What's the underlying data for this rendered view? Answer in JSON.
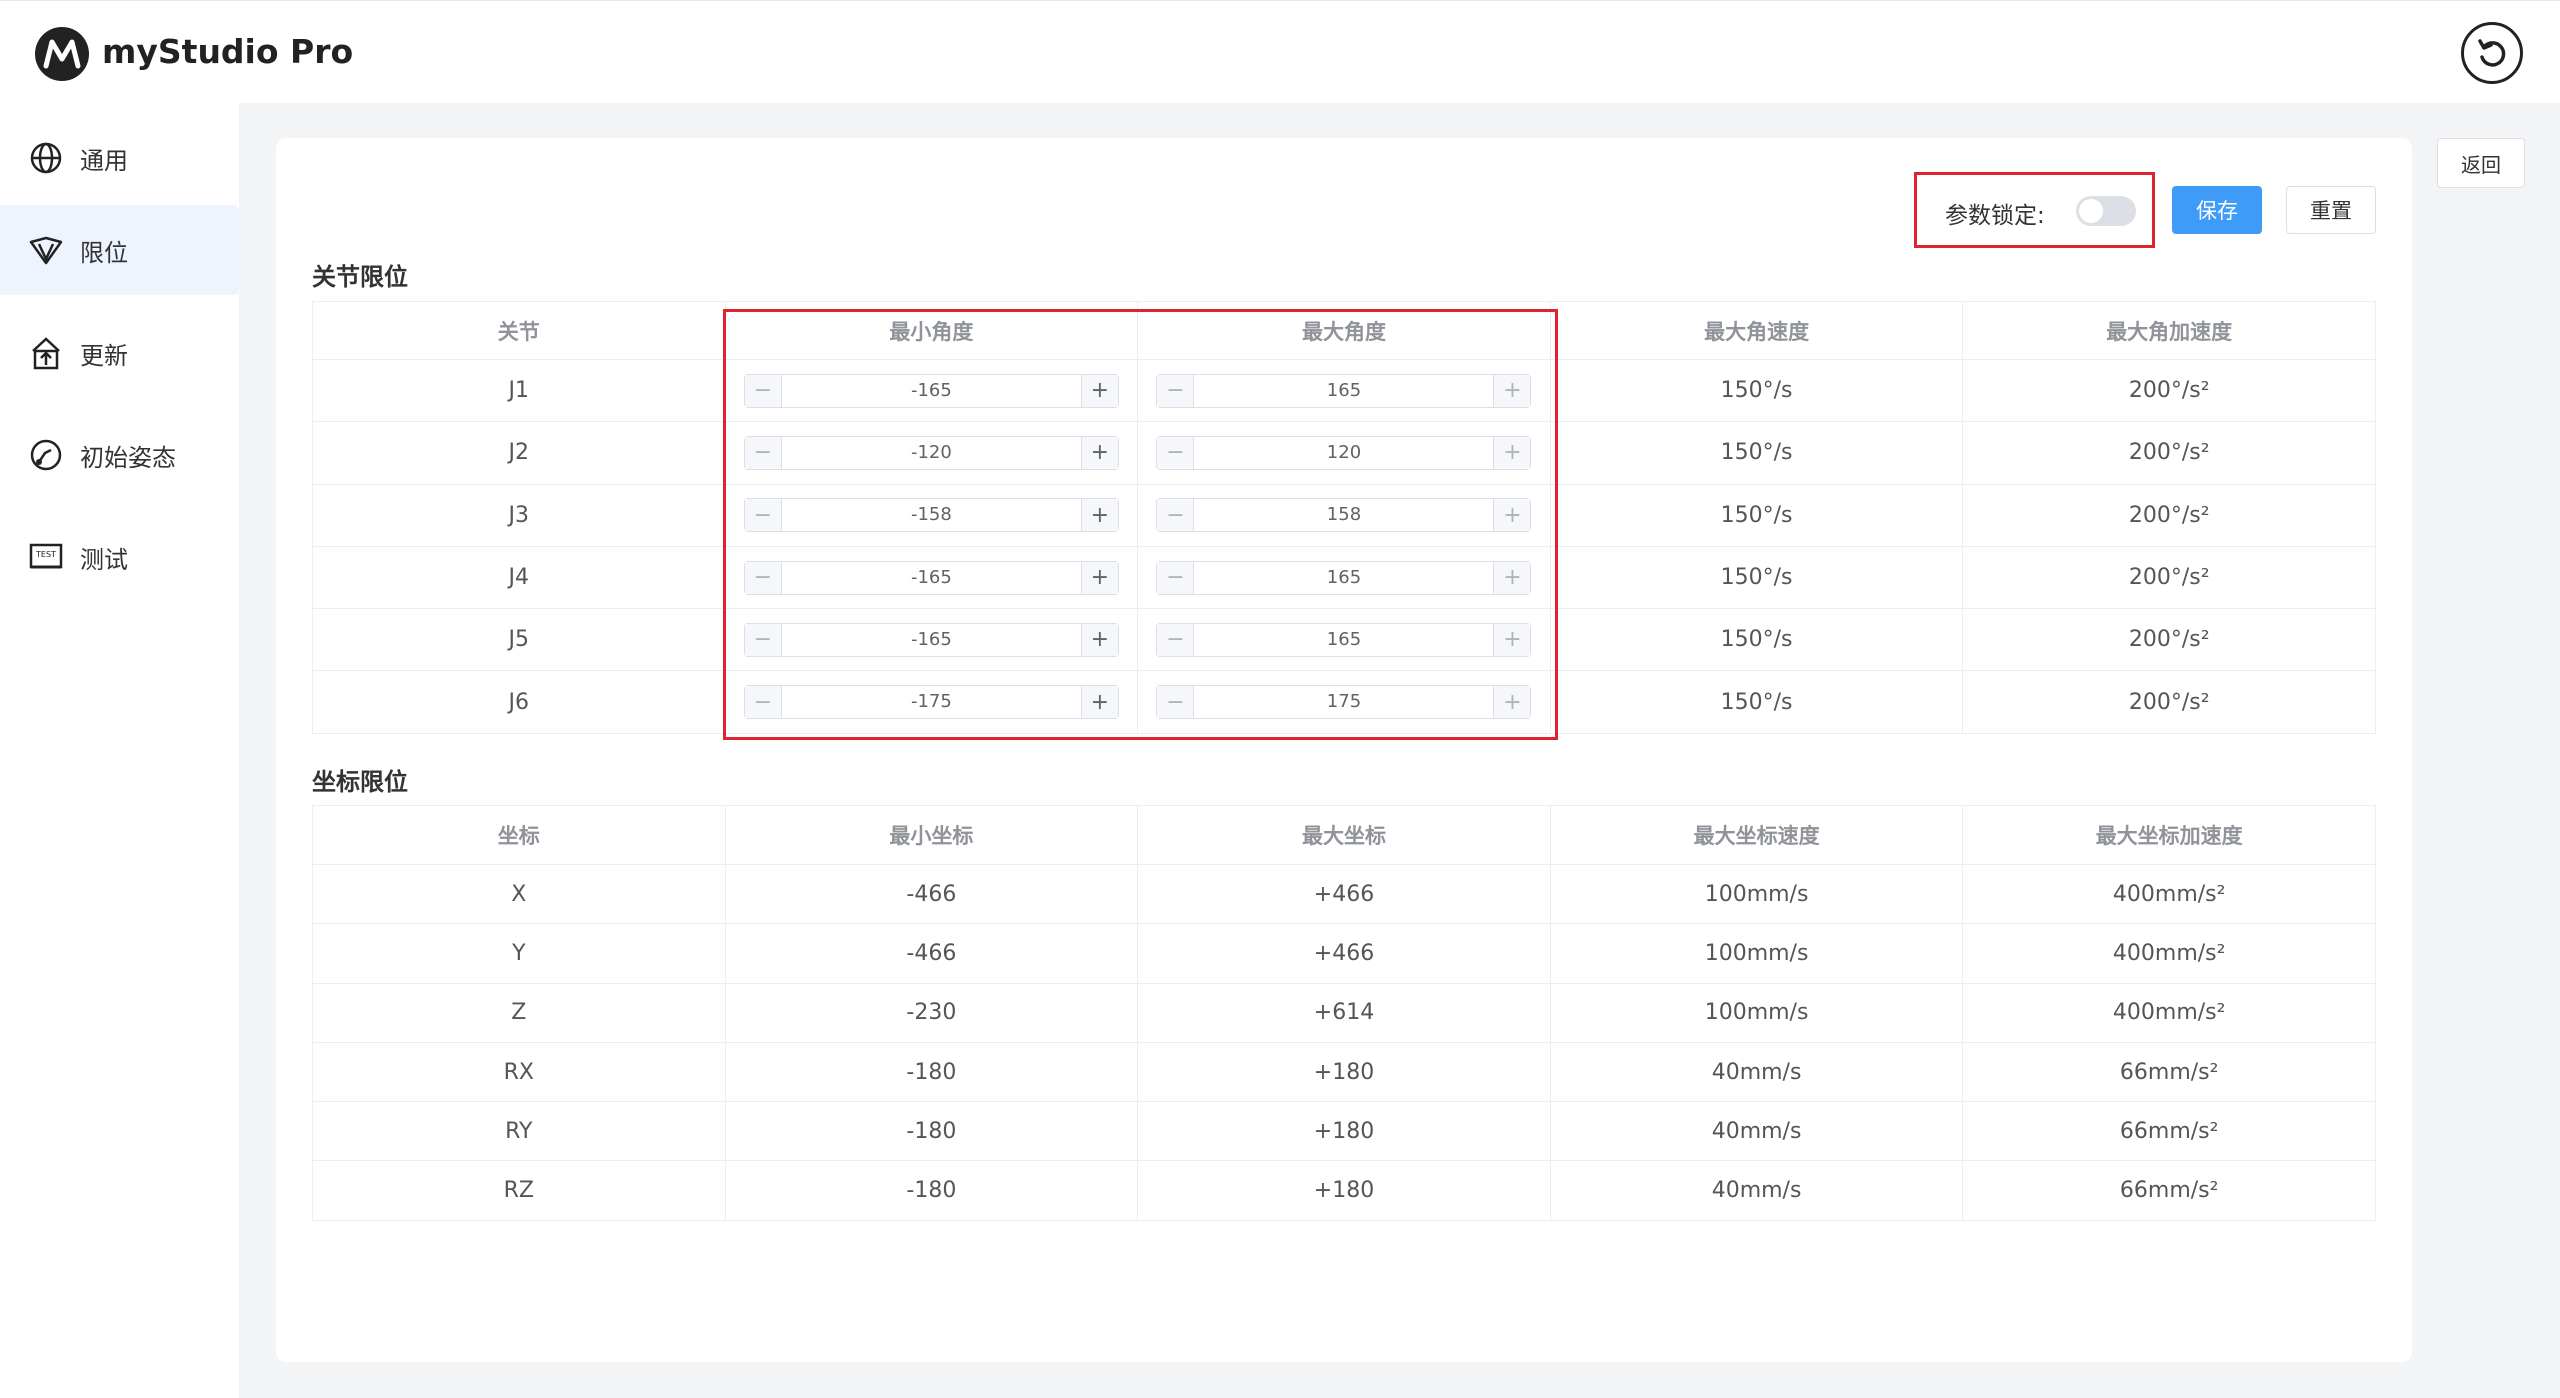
{
  "app": {
    "title": "myStudio Pro"
  },
  "sidebar": {
    "items": [
      {
        "label": "通用",
        "icon": "globe-icon",
        "active": false
      },
      {
        "label": "限位",
        "icon": "limit-icon",
        "active": true
      },
      {
        "label": "更新",
        "icon": "update-icon",
        "active": false
      },
      {
        "label": "初始姿态",
        "icon": "pose-icon",
        "active": false
      },
      {
        "label": "测试",
        "icon": "test-icon",
        "active": false
      }
    ]
  },
  "toolbar": {
    "back_label": "返回",
    "lock_label": "参数锁定:",
    "lock_on": false,
    "save_label": "保存",
    "reset_label": "重置"
  },
  "joint_section": {
    "title": "关节限位",
    "headers": [
      "关节",
      "最小角度",
      "最大角度",
      "最大角速度",
      "最大角加速度"
    ],
    "rows": [
      {
        "joint": "J1",
        "min": "-165",
        "max": "165",
        "vel": "150°/s",
        "acc": "200°/s²"
      },
      {
        "joint": "J2",
        "min": "-120",
        "max": "120",
        "vel": "150°/s",
        "acc": "200°/s²"
      },
      {
        "joint": "J3",
        "min": "-158",
        "max": "158",
        "vel": "150°/s",
        "acc": "200°/s²"
      },
      {
        "joint": "J4",
        "min": "-165",
        "max": "165",
        "vel": "150°/s",
        "acc": "200°/s²"
      },
      {
        "joint": "J5",
        "min": "-165",
        "max": "165",
        "vel": "150°/s",
        "acc": "200°/s²"
      },
      {
        "joint": "J6",
        "min": "-175",
        "max": "175",
        "vel": "150°/s",
        "acc": "200°/s²"
      }
    ],
    "stepper_minus": "−",
    "stepper_plus": "+"
  },
  "coord_section": {
    "title": "坐标限位",
    "headers": [
      "坐标",
      "最小坐标",
      "最大坐标",
      "最大坐标速度",
      "最大坐标加速度"
    ],
    "rows": [
      {
        "axis": "X",
        "min": "-466",
        "max": "+466",
        "vel": "100mm/s",
        "acc": "400mm/s²"
      },
      {
        "axis": "Y",
        "min": "-466",
        "max": "+466",
        "vel": "100mm/s",
        "acc": "400mm/s²"
      },
      {
        "axis": "Z",
        "min": "-230",
        "max": "+614",
        "vel": "100mm/s",
        "acc": "400mm/s²"
      },
      {
        "axis": "RX",
        "min": "-180",
        "max": "+180",
        "vel": "40mm/s",
        "acc": "66mm/s²"
      },
      {
        "axis": "RY",
        "min": "-180",
        "max": "+180",
        "vel": "40mm/s",
        "acc": "66mm/s²"
      },
      {
        "axis": "RZ",
        "min": "-180",
        "max": "+180",
        "vel": "40mm/s",
        "acc": "66mm/s²"
      }
    ]
  },
  "colors": {
    "accent": "#3e9bf8",
    "highlight": "#e0232f",
    "active_bg": "#eef4fe"
  }
}
